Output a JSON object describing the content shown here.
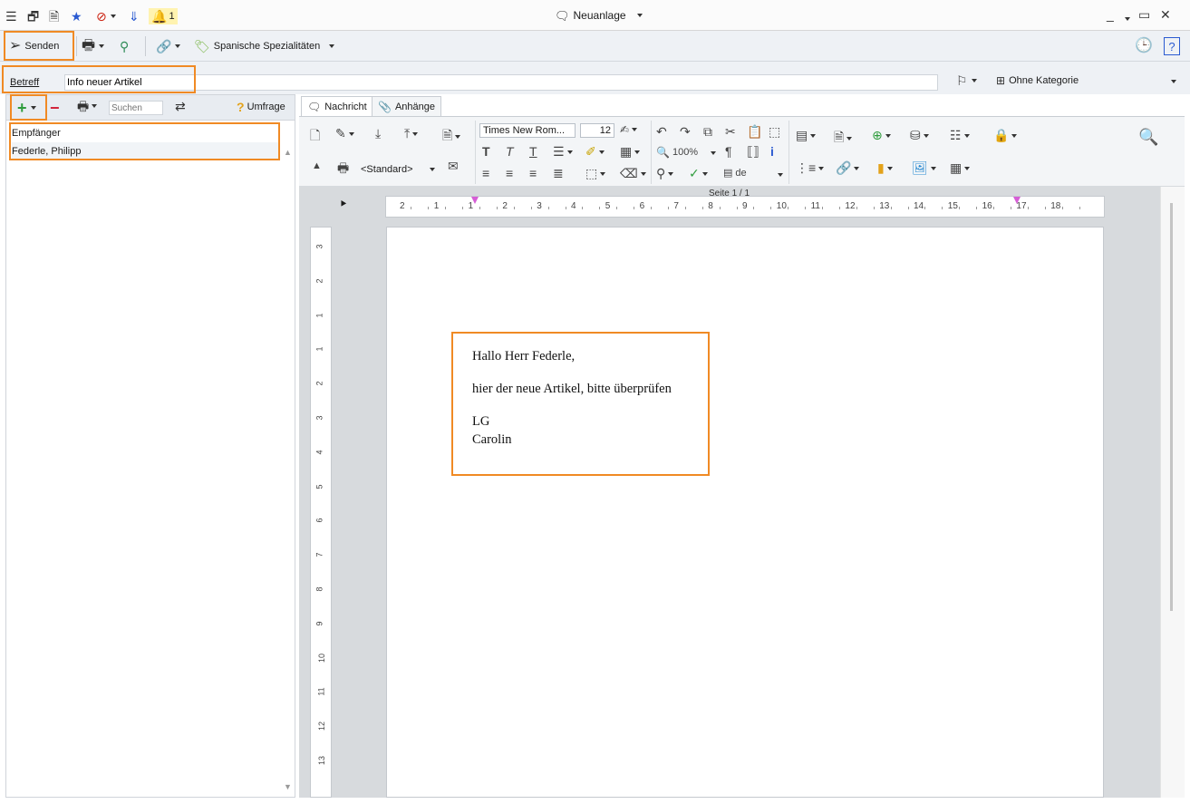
{
  "window": {
    "title": "Neuanlage",
    "notification_count": "1"
  },
  "toolbar": {
    "send_label": "Senden",
    "category_label": "Spanische Spezialitäten"
  },
  "subject": {
    "label": "Betreff",
    "value": "Info neuer Artikel",
    "category": "Ohne Kategorie"
  },
  "recipients": {
    "search_placeholder": "Suchen",
    "survey_label": "Umfrage",
    "header": "Empfänger",
    "items": [
      "Federle, Philipp"
    ]
  },
  "editor": {
    "tabs": [
      "Nachricht",
      "Anhänge"
    ],
    "font_name": "Times New Rom...",
    "font_size": "12",
    "zoom": "100%",
    "style": "<Standard>",
    "language": "de",
    "page_indicator": "Seite 1 / 1",
    "hruler_labels": [
      "2",
      "1",
      "1",
      "2",
      "3",
      "4",
      "5",
      "6",
      "7",
      "8",
      "9",
      "10",
      "11",
      "12",
      "13",
      "14",
      "15",
      "16",
      "17",
      "18"
    ],
    "vruler_labels": [
      "3",
      "2",
      "1",
      "1",
      "2",
      "3",
      "4",
      "5",
      "6",
      "7",
      "8",
      "9",
      "10",
      "11",
      "12",
      "13"
    ]
  },
  "letter": {
    "greeting": "Hallo Herr Federle,",
    "body": "hier der neue Artikel, bitte überprüfen",
    "closing": "LG",
    "signature": "Carolin"
  },
  "colors": {
    "highlight": "#f08a24",
    "toolbar_bg": "#eef1f5",
    "canvas_bg": "#d7dadd"
  }
}
